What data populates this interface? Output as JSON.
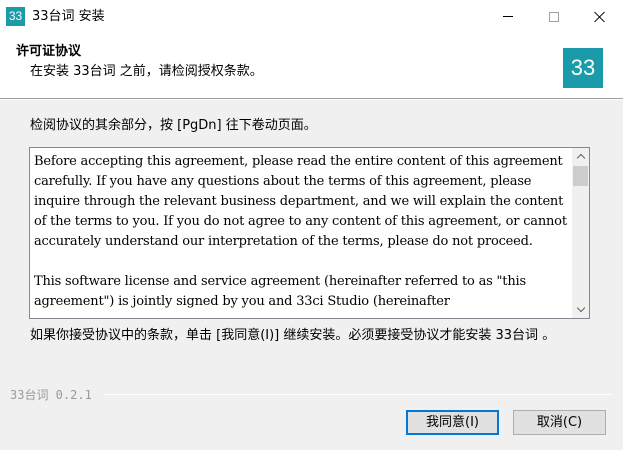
{
  "window": {
    "icon_text": "33",
    "title": "33台词 安装"
  },
  "header": {
    "title": "许可证协议",
    "subtitle": "在安装 33台词 之前，请检阅授权条款。",
    "logo_text": "33"
  },
  "content": {
    "instruction": "检阅协议的其余部分，按 [PgDn] 往下卷动页面。",
    "license_text": "Before accepting this agreement, please read the entire content of this agreement carefully. If you have any questions about the terms of this agreement, please inquire through the relevant business department, and we will explain the content of the terms to you. If you do not agree to any content of this agreement, or cannot accurately understand our interpretation of the terms, please do not proceed.\n\nThis software license and service agreement (hereinafter referred to as \"this agreement\") is jointly signed by you and 33ci Studio (hereinafter",
    "agree_note": "如果你接受协议中的条款，单击 [我同意(I)] 继续安装。必须要接受协议才能安装 33台词 。"
  },
  "footer": {
    "version": "33台词 0.2.1",
    "agree_button": "我同意(I)",
    "cancel_button": "取消(C)"
  },
  "colors": {
    "brand": "#1b9aaa",
    "focus_border": "#0078d7"
  }
}
